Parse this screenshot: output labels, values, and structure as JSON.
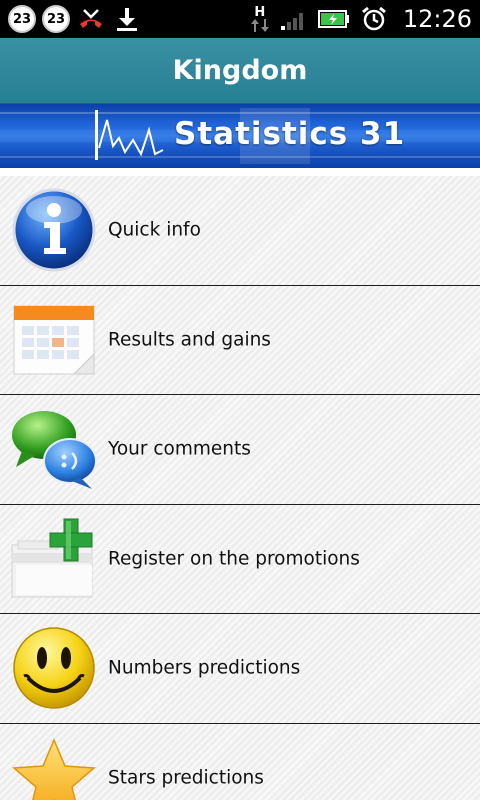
{
  "status_bar": {
    "notification_badges": [
      "23",
      "23"
    ],
    "clock": "12:26",
    "network_label": "H",
    "battery_color": "#39c54a"
  },
  "header": {
    "title": "Kingdom",
    "bg_color": "#2e879a"
  },
  "banner": {
    "title": "Statistics 31"
  },
  "menu": {
    "items": [
      {
        "label": "Quick info",
        "icon": "info-icon"
      },
      {
        "label": "Results and gains",
        "icon": "calendar-icon"
      },
      {
        "label": "Your comments",
        "icon": "chat-bubbles-icon"
      },
      {
        "label": "Register on the promotions",
        "icon": "add-folder-icon"
      },
      {
        "label": "Numbers predictions",
        "icon": "smiley-icon"
      },
      {
        "label": "Stars predictions",
        "icon": "star-icon"
      }
    ]
  }
}
